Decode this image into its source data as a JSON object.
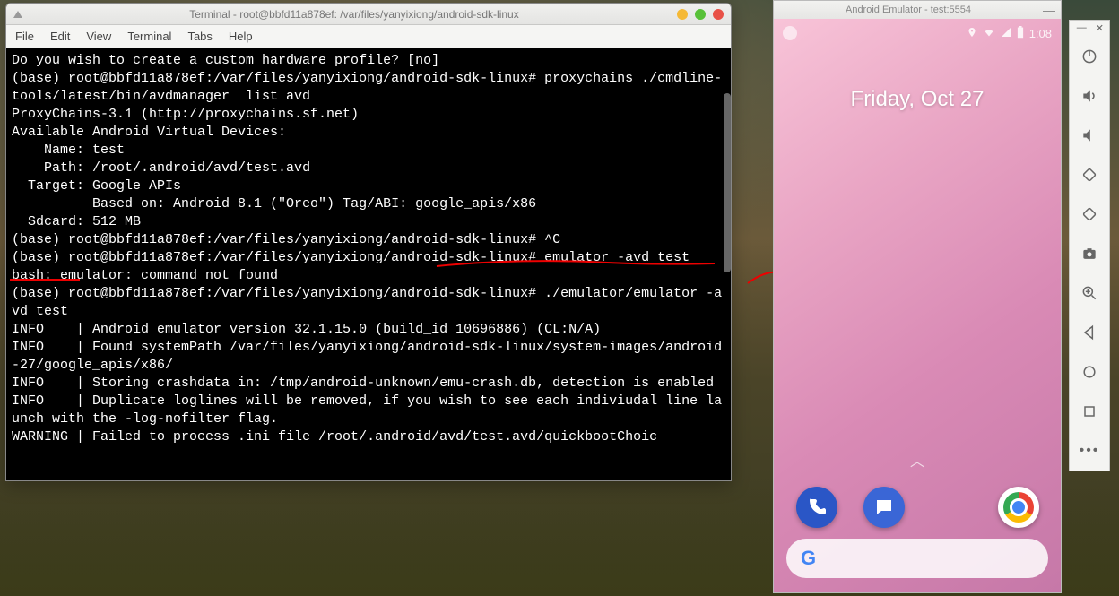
{
  "terminal": {
    "title": "Terminal - root@bbfd11a878ef: /var/files/yanyixiong/android-sdk-linux",
    "menu": {
      "file": "File",
      "edit": "Edit",
      "view": "View",
      "terminal": "Terminal",
      "tabs": "Tabs",
      "help": "Help"
    },
    "content": "Do you wish to create a custom hardware profile? [no]\n(base) root@bbfd11a878ef:/var/files/yanyixiong/android-sdk-linux# proxychains ./cmdline-tools/latest/bin/avdmanager  list avd\nProxyChains-3.1 (http://proxychains.sf.net)\nAvailable Android Virtual Devices:\n    Name: test\n    Path: /root/.android/avd/test.avd\n  Target: Google APIs\n          Based on: Android 8.1 (\"Oreo\") Tag/ABI: google_apis/x86\n  Sdcard: 512 MB\n(base) root@bbfd11a878ef:/var/files/yanyixiong/android-sdk-linux# ^C\n(base) root@bbfd11a878ef:/var/files/yanyixiong/android-sdk-linux# emulator -avd test\nbash: emulator: command not found\n(base) root@bbfd11a878ef:/var/files/yanyixiong/android-sdk-linux# ./emulator/emulator -avd test\nINFO    | Android emulator version 32.1.15.0 (build_id 10696886) (CL:N/A)\nINFO    | Found systemPath /var/files/yanyixiong/android-sdk-linux/system-images/android-27/google_apis/x86/\nINFO    | Storing crashdata in: /tmp/android-unknown/emu-crash.db, detection is enabled\nINFO    | Duplicate loglines will be removed, if you wish to see each indiviudal line launch with the -log-nofilter flag.\nWARNING | Failed to process .ini file /root/.android/avd/test.avd/quickbootChoic"
  },
  "emulator": {
    "title": "Android Emulator - test:5554",
    "status": {
      "time": "1:08"
    },
    "date": "Friday, Oct 27",
    "search_logo": "G"
  },
  "toolbar_labels": {
    "minimize": "—",
    "close": "✕"
  }
}
